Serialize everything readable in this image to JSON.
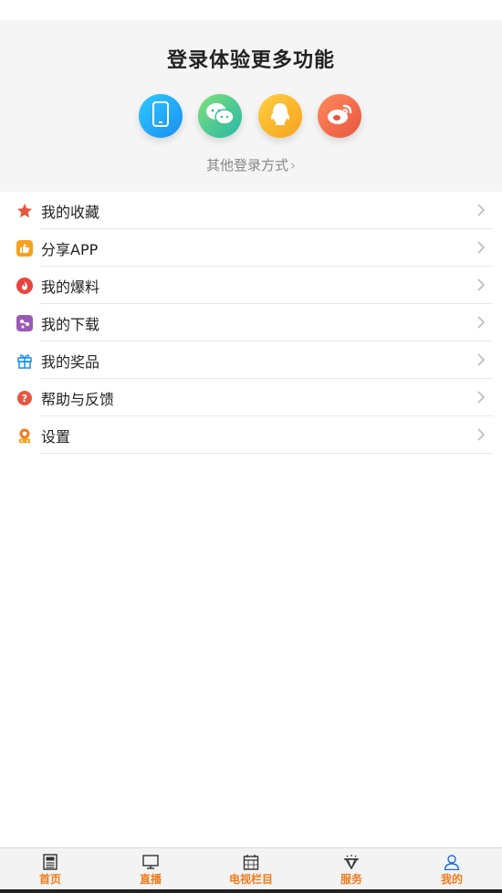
{
  "login": {
    "title": "登录体验更多功能",
    "methods": [
      {
        "icon": "phone-icon",
        "color": "#1a8ef0"
      },
      {
        "icon": "wechat-icon",
        "color": "#27b7a8"
      },
      {
        "icon": "qq-icon",
        "color": "#f6a11c"
      },
      {
        "icon": "weibo-icon",
        "color": "#e8553f"
      }
    ],
    "other_label": "其他登录方式"
  },
  "menu": [
    {
      "label": "我的收藏",
      "icon": "star-icon",
      "color": "#e8553f"
    },
    {
      "label": "分享APP",
      "icon": "thumbs-up-icon",
      "color": "#f6a11c"
    },
    {
      "label": "我的爆料",
      "icon": "flame-icon",
      "color": "#e8453f"
    },
    {
      "label": "我的下载",
      "icon": "download-icon",
      "color": "#9b59b6"
    },
    {
      "label": "我的奖品",
      "icon": "gift-icon",
      "color": "#1a8ef0"
    },
    {
      "label": "帮助与反馈",
      "icon": "help-icon",
      "color": "#e8553f"
    },
    {
      "label": "设置",
      "icon": "settings-icon",
      "color": "#f07c1c"
    }
  ],
  "tabs": [
    {
      "label": "首页",
      "icon": "news-icon"
    },
    {
      "label": "直播",
      "icon": "tv-icon"
    },
    {
      "label": "电视栏目",
      "icon": "calendar-icon"
    },
    {
      "label": "服务",
      "icon": "diamond-icon"
    },
    {
      "label": "我的",
      "icon": "user-icon",
      "active": true
    }
  ],
  "accent_color": "#f07c1c"
}
